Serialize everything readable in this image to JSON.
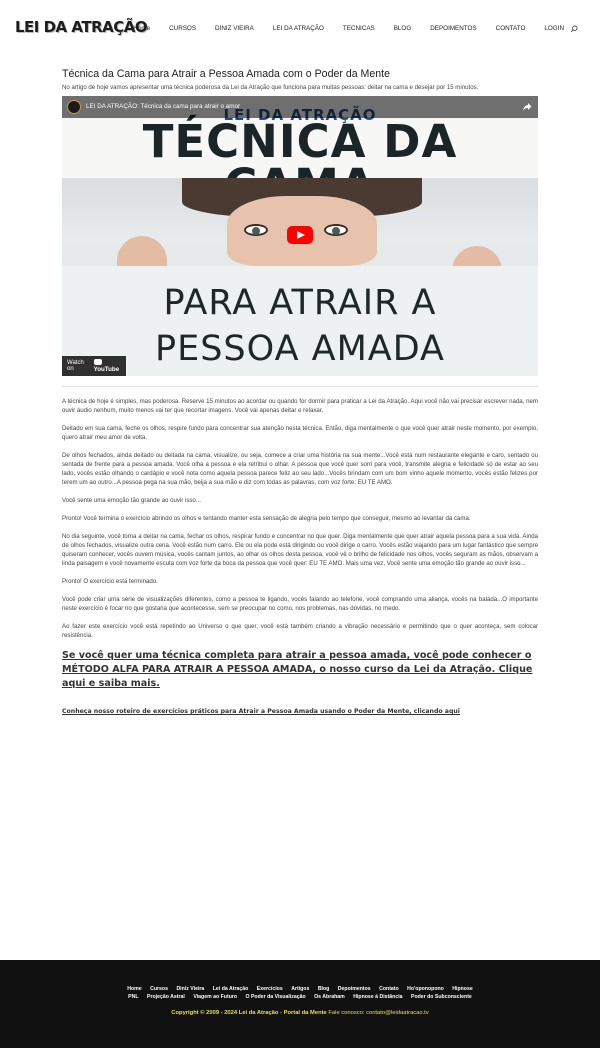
{
  "header": {
    "logo_text": "LEI DA ATRAÇÃO",
    "nav": [
      "Home",
      "CURSOS",
      "DINIZ VIEIRA",
      "LEI DA ATRAÇÃO",
      "TECNICAS",
      "BLOG",
      "DEPOIMENTOS",
      "CONTATO",
      "LOGIN"
    ]
  },
  "article": {
    "title": "Técnica da Cama para Atrair a Pessoa Amada com o Poder da Mente",
    "intro": "No artigo de hoje vamos apresentar uma técnica poderosa da Lei da Atração que funciona para muitas pessoas: deitar na cama e desejar por 15 minutos.",
    "video": {
      "bar_title": "LEI DA ATRAÇÃO: Técnica da cama para atrair o amor",
      "brand_line": "LEI DA ATRAÇÃO",
      "big_title_1": "TÉCNICA DA CAMA",
      "big_title_2_line1": "PARA ATRAIR A",
      "big_title_2_line2": "PESSOA AMADA",
      "watch_on": "Watch on",
      "yt_label": "YouTube"
    },
    "paragraphs": [
      "A técnica de hoje é simples, mas poderosa. Reserve 15 minutos ao acordar ou quando for dormir para praticar a Lei da Atração. Aqui você não vai precisar escrever nada, nem ouvir áudio nenhum, muito menos vai ter que recortar imagens. Você vai apenas deitar e relaxar.",
      "Deitado em sua cama, feche os olhos, respire fundo para concentrar sua atenção nesta técnica. Então, diga mentalmente o que você quer atrair neste momento, por exemplo, quero atrair meu amor de volta.",
      "De olhos fechados, ainda deitado ou deitada na cama, visualize, ou seja, comece a criar uma história na sua mente...Você está num restaurante elegante e caro, sentado ou sentada de frente para a pessoa amada. Você olha a pessoa e ela retribui o olhar. A pessoa que você quer sorri para você, transmite alegria e felicidade só de estar ao seu lado, vocês estão olhando o cardápio e você nota como aquela pessoa parece feliz ao seu lado...Vocês brindam com um bom vinho aquele momento, vocês estão felizes por terem um ao outro...A pessoa pega na sua mão, beija a sua mão e diz com todas as palavras, com voz forte: EU TE AMO.",
      "Você sente uma emoção tão grande ao ouvir isso...",
      "Pronto! Você termina o exercício abrindo os olhos e tentando manter esta sensação de alegria pelo tempo que conseguir, mesmo ao levantar da cama.",
      "No dia seguinte, você torna a deitar na cama, fechar os olhos, respirar fundo e concentrar no que quer. Diga mentalmente que quer atrair aquela pessoa para a sua vida. Ainda de olhos fechados, visualize outra cena. Você estão num carro. Ele ou ela pode está dirigindo ou você dirige o carro. Vocês estão viajando para um lugar fantástico que sempre quiseram conhecer, vocês ouvem música, vocês cantam juntos, ao olhar os olhos desta pessoa, você vê o brilho de felicidade nos olhos, vocês seguram as mãos, observam a linda paisagem e você novamente escuta com voz forte da boca da pessoa que você quer: EU TE AMO. Mais uma vez, Você sente uma emoção tão grande ao ouvir isso...",
      "Pronto! O exercício está terminado.",
      "Você pode criar uma série de visualizações diferentes, como a pessoa te ligando, vocês falando ao telefone, você comprando uma aliança, vocês na balada...O importante neste exercício é focar no que gostaria que acontecesse, sem se preocupar no como, nos problemas, nas dúvidas, no medo.",
      "Ao fazer este exercício você está repetindo ao Universo o que quer, você está também criando a vibração necessário e permitindo que o quer aconteça, sem colocar resistência."
    ],
    "cta_big": "Se você quer uma técnica completa para atrair a pessoa amada, você pode conhecer o MÉTODO ALFA PARA ATRAIR A PESSOA AMADA, o nosso curso da Lei da Atração. Clique aqui e saiba mais.",
    "cta_small": "Conheça nosso roteiro de exercícios práticos para Atrair a Pessoa Amada usando o Poder da Mente, clicando aqui"
  },
  "footer": {
    "row1": [
      "Home",
      "Cursos",
      "Diniz Vieira",
      "Lei da Atração",
      "Exercícios",
      "Artigos",
      "Blog",
      "Depoimentos",
      "Contato",
      "Ho'oponopono",
      "Hipnose"
    ],
    "row2": [
      "PNL",
      "Projeção Astral",
      "Viagem ao Futuro",
      "O Poder da Visualização",
      "Os Abraham",
      "Hipnose à Distância",
      "Poder do Subconsciente"
    ],
    "copyright": "Copyright © 2009 - 2024 Lei da Atração - Portal da Mente",
    "contact": "Fale conosco: contato@leidaatracao.tv"
  }
}
